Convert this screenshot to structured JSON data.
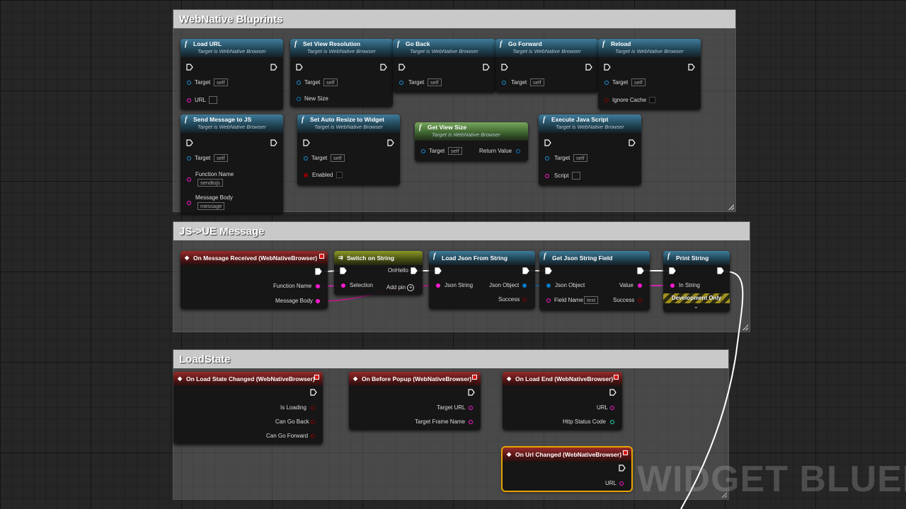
{
  "comments": {
    "webnative": "WebNative Bluprints",
    "jsue": "JS->UE Message",
    "loadstate": "LoadState"
  },
  "watermark": "WIDGET BLUEPRI",
  "common": {
    "target_label": "Target",
    "target_value": "self",
    "subtitle_browser": "Target is WebNative Browser"
  },
  "nodes": {
    "load_url": {
      "title": "Load URL",
      "url_label": "URL"
    },
    "set_view_resolution": {
      "title": "Set View Resolution",
      "new_size_label": "New Size"
    },
    "go_back": {
      "title": "Go Back"
    },
    "go_forward": {
      "title": "Go Forward"
    },
    "reload": {
      "title": "Reload",
      "ignore_cache_label": "Ignore Cache"
    },
    "send_message": {
      "title": "Send Message to JS",
      "function_name_label": "Function Name",
      "function_name_value": "sendtojs",
      "message_body_label": "Message Body",
      "message_body_value": "message"
    },
    "set_auto_resize": {
      "title": "Set Auto Resize to Widget",
      "enabled_label": "Enabled"
    },
    "get_view_size": {
      "title": "Get View Size",
      "return_label": "Return Value"
    },
    "execute_js": {
      "title": "Execute Java Script",
      "script_label": "Script"
    },
    "on_message_received": {
      "title": "On Message Received (WebNativeBrowser)",
      "function_name_label": "Function Name",
      "message_body_label": "Message Body"
    },
    "switch_on_string": {
      "title": "Switch on String",
      "onhello_label": "OnHello",
      "selection_label": "Selection",
      "add_pin_label": "Add pin"
    },
    "load_json": {
      "title": "Load Json From String",
      "json_string_label": "Json String",
      "json_object_label": "Json Object",
      "success_label": "Success"
    },
    "get_json_field": {
      "title": "Get Json String Field",
      "json_object_label": "Json Object",
      "value_label": "Value",
      "field_name_label": "Field Name",
      "field_name_value": "text",
      "success_label": "Success"
    },
    "print_string": {
      "title": "Print String",
      "in_string_label": "In String",
      "dev_only_label": "Development Only"
    },
    "on_load_state_changed": {
      "title": "On Load State Changed (WebNativeBrowser)",
      "is_loading_label": "Is Loading",
      "can_go_back_label": "Can Go Back",
      "can_go_forward_label": "Can Go Forward"
    },
    "on_before_popup": {
      "title": "On Before Popup (WebNativeBrowser)",
      "target_url_label": "Target URL",
      "target_frame_label": "Target Frame Name"
    },
    "on_load_end": {
      "title": "On Load End (WebNativeBrowser)",
      "url_label": "URL",
      "http_status_label": "Http Status Code"
    },
    "on_url_changed": {
      "title": "On Url Changed (WebNativeBrowser)",
      "url_label": "URL"
    }
  },
  "colors": {
    "exec": "#ffffff",
    "object_pin": "#1e8fd6",
    "string_pin": "#ff1ad0",
    "bool_pin": "#8b0000",
    "int_pin": "#1fe3af",
    "struct_pin": "#0a79c9",
    "selected_outline": "#e8a400"
  }
}
